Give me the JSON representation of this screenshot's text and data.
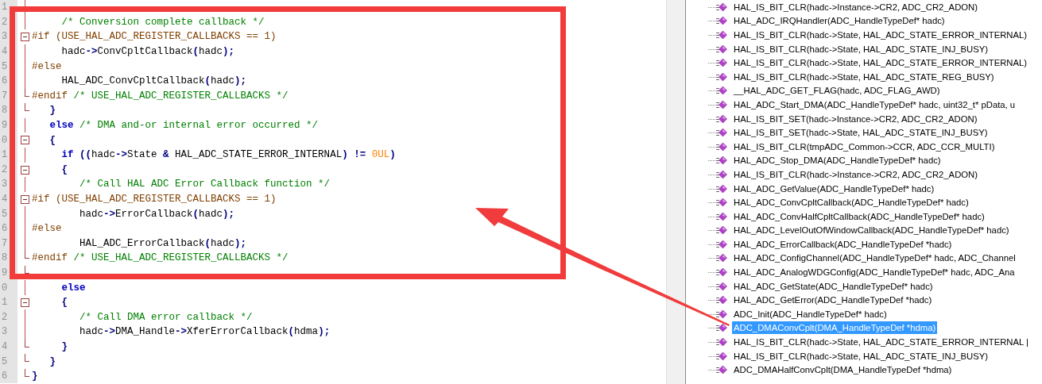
{
  "editor": {
    "lines": [
      {
        "number": "1",
        "fold_start": false,
        "fold_end": false
      },
      {
        "number": "2",
        "fold_start": false,
        "fold_end": false,
        "code": [
          {
            "kind": "comment",
            "text": "     /* Conversion complete callback */"
          }
        ]
      },
      {
        "number": "3",
        "fold_start": true,
        "fold_end": false,
        "code": [
          {
            "kind": "preproc",
            "text": "#if (USE_HAL_ADC_REGISTER_CALLBACKS == 1)"
          }
        ]
      },
      {
        "number": "4",
        "fold_start": false,
        "fold_end": false,
        "code": [
          {
            "kind": "plain",
            "text": "     hadc"
          },
          {
            "kind": "op",
            "text": "->"
          },
          {
            "kind": "plain",
            "text": "ConvCpltCallback"
          },
          {
            "kind": "op",
            "text": "("
          },
          {
            "kind": "plain",
            "text": "hadc"
          },
          {
            "kind": "op",
            "text": ");"
          }
        ]
      },
      {
        "number": "5",
        "fold_start": false,
        "fold_end": false,
        "code": [
          {
            "kind": "preproc",
            "text": "#else"
          }
        ]
      },
      {
        "number": "6",
        "fold_start": false,
        "fold_end": false,
        "code": [
          {
            "kind": "plain",
            "text": "     HAL_ADC_ConvCpltCallback"
          },
          {
            "kind": "op",
            "text": "("
          },
          {
            "kind": "plain",
            "text": "hadc"
          },
          {
            "kind": "op",
            "text": ");"
          }
        ]
      },
      {
        "number": "7",
        "fold_start": false,
        "fold_end": true,
        "code": [
          {
            "kind": "preproc",
            "text": "#endif "
          },
          {
            "kind": "comment",
            "text": "/* USE_HAL_ADC_REGISTER_CALLBACKS */"
          }
        ]
      },
      {
        "number": "8",
        "fold_start": false,
        "fold_end": true,
        "code": [
          {
            "kind": "op",
            "text": "   }"
          }
        ]
      },
      {
        "number": "9",
        "fold_start": false,
        "fold_end": false,
        "code": [
          {
            "kind": "keyword",
            "text": "   else "
          },
          {
            "kind": "comment",
            "text": "/* DMA and-or internal error occurred */"
          }
        ]
      },
      {
        "number": "0",
        "fold_start": true,
        "fold_end": false,
        "code": [
          {
            "kind": "op",
            "text": "   {"
          }
        ]
      },
      {
        "number": "1",
        "fold_start": false,
        "fold_end": false,
        "code": [
          {
            "kind": "keyword",
            "text": "     if "
          },
          {
            "kind": "op",
            "text": "(("
          },
          {
            "kind": "plain",
            "text": "hadc"
          },
          {
            "kind": "op",
            "text": "->"
          },
          {
            "kind": "plain",
            "text": "State "
          },
          {
            "kind": "op",
            "text": "& "
          },
          {
            "kind": "plain",
            "text": "HAL_ADC_STATE_ERROR_INTERNAL"
          },
          {
            "kind": "op",
            "text": ") != "
          },
          {
            "kind": "number",
            "text": "0UL"
          },
          {
            "kind": "op",
            "text": ")"
          }
        ]
      },
      {
        "number": "2",
        "fold_start": true,
        "fold_end": false,
        "code": [
          {
            "kind": "op",
            "text": "     {"
          }
        ]
      },
      {
        "number": "3",
        "fold_start": false,
        "fold_end": false,
        "code": [
          {
            "kind": "comment",
            "text": "        /* Call HAL ADC Error Callback function */"
          }
        ]
      },
      {
        "number": "4",
        "fold_start": true,
        "fold_end": false,
        "code": [
          {
            "kind": "preproc",
            "text": "#if (USE_HAL_ADC_REGISTER_CALLBACKS == 1)"
          }
        ]
      },
      {
        "number": "5",
        "fold_start": false,
        "fold_end": false,
        "code": [
          {
            "kind": "plain",
            "text": "        hadc"
          },
          {
            "kind": "op",
            "text": "->"
          },
          {
            "kind": "plain",
            "text": "ErrorCallback"
          },
          {
            "kind": "op",
            "text": "("
          },
          {
            "kind": "plain",
            "text": "hadc"
          },
          {
            "kind": "op",
            "text": ");"
          }
        ]
      },
      {
        "number": "6",
        "fold_start": false,
        "fold_end": false,
        "code": [
          {
            "kind": "preproc",
            "text": "#else"
          }
        ]
      },
      {
        "number": "7",
        "fold_start": false,
        "fold_end": false,
        "code": [
          {
            "kind": "plain",
            "text": "        HAL_ADC_ErrorCallback"
          },
          {
            "kind": "op",
            "text": "("
          },
          {
            "kind": "plain",
            "text": "hadc"
          },
          {
            "kind": "op",
            "text": ");"
          }
        ]
      },
      {
        "number": "8",
        "fold_start": false,
        "fold_end": true,
        "code": [
          {
            "kind": "preproc",
            "text": "#endif "
          },
          {
            "kind": "comment",
            "text": "/* USE_HAL_ADC_REGISTER_CALLBACKS */"
          }
        ]
      },
      {
        "number": "9",
        "fold_start": false,
        "fold_end": true
      },
      {
        "number": "0",
        "fold_start": false,
        "fold_end": false,
        "code": [
          {
            "kind": "keyword",
            "text": "     else"
          }
        ]
      },
      {
        "number": "1",
        "fold_start": true,
        "fold_end": false,
        "code": [
          {
            "kind": "op",
            "text": "     {"
          }
        ]
      },
      {
        "number": "2",
        "fold_start": false,
        "fold_end": false,
        "code": [
          {
            "kind": "comment",
            "text": "        /* Call DMA error callback */"
          }
        ]
      },
      {
        "number": "3",
        "fold_start": false,
        "fold_end": false,
        "code": [
          {
            "kind": "plain",
            "text": "        hadc"
          },
          {
            "kind": "op",
            "text": "->"
          },
          {
            "kind": "plain",
            "text": "DMA_Handle"
          },
          {
            "kind": "op",
            "text": "->"
          },
          {
            "kind": "plain",
            "text": "XferErrorCallback"
          },
          {
            "kind": "op",
            "text": "("
          },
          {
            "kind": "plain",
            "text": "hdma"
          },
          {
            "kind": "op",
            "text": ");"
          }
        ]
      },
      {
        "number": "4",
        "fold_start": false,
        "fold_end": true,
        "code": [
          {
            "kind": "op",
            "text": "     }"
          }
        ]
      },
      {
        "number": "5",
        "fold_start": false,
        "fold_end": true,
        "code": [
          {
            "kind": "op",
            "text": "   }"
          }
        ]
      },
      {
        "number": "6",
        "fold_start": false,
        "fold_end": true,
        "code": [
          {
            "kind": "op",
            "text": "}"
          }
        ]
      }
    ]
  },
  "outline": {
    "items": [
      {
        "label": "HAL_IS_BIT_CLR(hadc->Instance->CR2, ADC_CR2_ADON)",
        "selected": false
      },
      {
        "label": "HAL_ADC_IRQHandler(ADC_HandleTypeDef* hadc)",
        "selected": false
      },
      {
        "label": "HAL_IS_BIT_CLR(hadc->State, HAL_ADC_STATE_ERROR_INTERNAL)",
        "selected": false
      },
      {
        "label": "HAL_IS_BIT_CLR(hadc->State, HAL_ADC_STATE_INJ_BUSY)",
        "selected": false
      },
      {
        "label": "HAL_IS_BIT_CLR(hadc->State, HAL_ADC_STATE_ERROR_INTERNAL)",
        "selected": false
      },
      {
        "label": "HAL_IS_BIT_CLR(hadc->State, HAL_ADC_STATE_REG_BUSY)",
        "selected": false
      },
      {
        "label": "__HAL_ADC_GET_FLAG(hadc, ADC_FLAG_AWD)",
        "selected": false
      },
      {
        "label": "HAL_ADC_Start_DMA(ADC_HandleTypeDef* hadc, uint32_t* pData, u",
        "selected": false
      },
      {
        "label": "HAL_IS_BIT_SET(hadc->Instance->CR2, ADC_CR2_ADON)",
        "selected": false
      },
      {
        "label": "HAL_IS_BIT_SET(hadc->State, HAL_ADC_STATE_INJ_BUSY)",
        "selected": false
      },
      {
        "label": "HAL_IS_BIT_CLR(tmpADC_Common->CCR, ADC_CCR_MULTI)",
        "selected": false
      },
      {
        "label": "HAL_ADC_Stop_DMA(ADC_HandleTypeDef* hadc)",
        "selected": false
      },
      {
        "label": "HAL_IS_BIT_CLR(hadc->Instance->CR2, ADC_CR2_ADON)",
        "selected": false
      },
      {
        "label": "HAL_ADC_GetValue(ADC_HandleTypeDef* hadc)",
        "selected": false
      },
      {
        "label": "HAL_ADC_ConvCpltCallback(ADC_HandleTypeDef* hadc)",
        "selected": false
      },
      {
        "label": "HAL_ADC_ConvHalfCpltCallback(ADC_HandleTypeDef* hadc)",
        "selected": false
      },
      {
        "label": "HAL_ADC_LevelOutOfWindowCallback(ADC_HandleTypeDef* hadc)",
        "selected": false
      },
      {
        "label": "HAL_ADC_ErrorCallback(ADC_HandleTypeDef *hadc)",
        "selected": false
      },
      {
        "label": "HAL_ADC_ConfigChannel(ADC_HandleTypeDef* hadc, ADC_Channel",
        "selected": false
      },
      {
        "label": "HAL_ADC_AnalogWDGConfig(ADC_HandleTypeDef* hadc, ADC_Ana",
        "selected": false
      },
      {
        "label": "HAL_ADC_GetState(ADC_HandleTypeDef* hadc)",
        "selected": false
      },
      {
        "label": "HAL_ADC_GetError(ADC_HandleTypeDef *hadc)",
        "selected": false
      },
      {
        "label": "ADC_Init(ADC_HandleTypeDef* hadc)",
        "selected": false
      },
      {
        "label": "ADC_DMAConvCplt(DMA_HandleTypeDef *hdma)",
        "selected": true
      },
      {
        "label": "HAL_IS_BIT_CLR(hadc->State, HAL_ADC_STATE_ERROR_INTERNAL |",
        "selected": false
      },
      {
        "label": "HAL_IS_BIT_CLR(hadc->State, HAL_ADC_STATE_INJ_BUSY)",
        "selected": false
      },
      {
        "label": "ADC_DMAHalfConvCplt(DMA_HandleTypeDef *hdma)",
        "selected": false
      }
    ]
  }
}
